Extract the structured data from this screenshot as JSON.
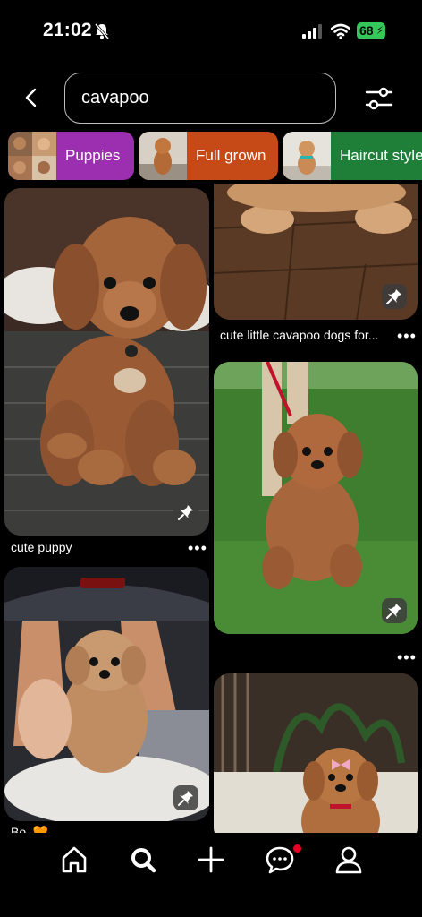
{
  "status": {
    "time": "21:02",
    "battery": "68"
  },
  "search": {
    "query": "cavapoo"
  },
  "chips": [
    {
      "label": "Puppies"
    },
    {
      "label": "Full grown"
    },
    {
      "label": "Haircut style"
    }
  ],
  "pins": {
    "left1": {
      "caption": "cute puppy"
    },
    "right1": {
      "caption": "cute little cavapoo dogs for..."
    },
    "left2": {
      "caption": "Bo..🧡"
    }
  },
  "more_label": "•••",
  "colors": {
    "puppies_chip": "#9c2fb0",
    "full_grown_chip": "#c54a17",
    "haircut_chip": "#1f7f39",
    "notification_dot": "#e60023"
  }
}
